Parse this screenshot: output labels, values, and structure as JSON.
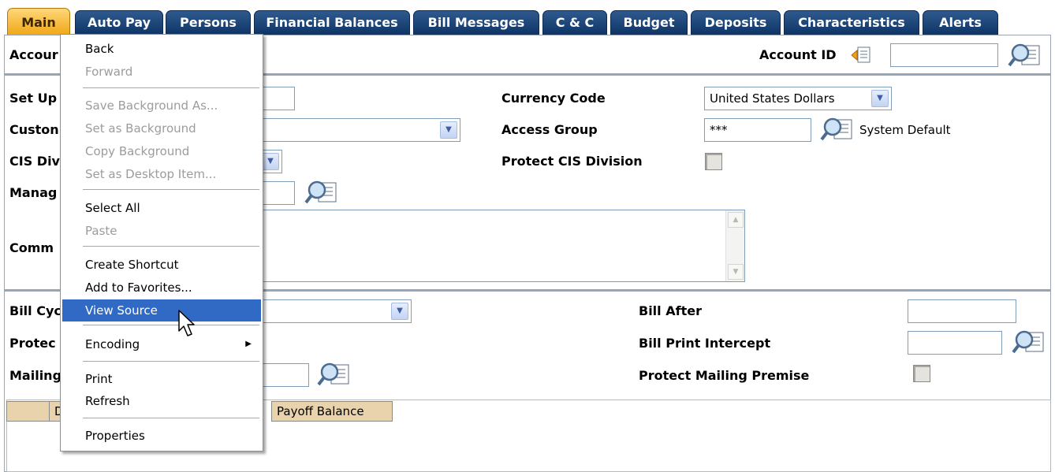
{
  "tabs": [
    {
      "label": "Main",
      "active": true
    },
    {
      "label": "Auto Pay"
    },
    {
      "label": "Persons"
    },
    {
      "label": "Financial Balances"
    },
    {
      "label": "Bill Messages"
    },
    {
      "label": "C & C"
    },
    {
      "label": "Budget"
    },
    {
      "label": "Deposits"
    },
    {
      "label": "Characteristics"
    },
    {
      "label": "Alerts"
    }
  ],
  "header": {
    "account_label_partial": "Accour",
    "account_id_label": "Account ID",
    "account_id_value": ""
  },
  "form": {
    "setup_label": "Set Up",
    "customer_label": "Custon",
    "cis_division_label": "CIS Div",
    "manager_label": "Manag",
    "comments_label": "Comm",
    "currency_code_label": "Currency Code",
    "currency_code_value": "United States Dollars",
    "access_group_label": "Access Group",
    "access_group_value": "***",
    "access_group_desc": "System Default",
    "protect_cis_label": "Protect CIS Division",
    "bill_cycle_label": "Bill Cyc",
    "protect_label": "Protec",
    "mailing_label": "Mailing",
    "bill_after_label": "Bill After",
    "bill_print_intercept_label": "Bill Print Intercept",
    "protect_mailing_premise_label": "Protect Mailing Premise"
  },
  "grid": {
    "col1_partial": "D",
    "col_payoff": "Payoff Balance"
  },
  "context_menu": {
    "items": [
      {
        "label": "Back",
        "disabled": false
      },
      {
        "label": "Forward",
        "disabled": true
      },
      {
        "label": "Save Background As...",
        "disabled": true
      },
      {
        "label": "Set as Background",
        "disabled": true
      },
      {
        "label": "Copy Background",
        "disabled": true
      },
      {
        "label": "Set as Desktop Item...",
        "disabled": true
      },
      {
        "label": "Select All",
        "disabled": false
      },
      {
        "label": "Paste",
        "disabled": true
      },
      {
        "label": "Create Shortcut",
        "disabled": false
      },
      {
        "label": "Add to Favorites...",
        "disabled": false
      },
      {
        "label": "View Source",
        "disabled": false,
        "highlighted": true
      },
      {
        "label": "Encoding",
        "disabled": false,
        "submenu": true
      },
      {
        "label": "Print",
        "disabled": false
      },
      {
        "label": "Refresh",
        "disabled": false
      },
      {
        "label": "Properties",
        "disabled": false
      }
    ]
  },
  "colors": {
    "tab_blue": "#1a4277",
    "tab_active": "#f5b52a",
    "menu_highlight": "#316ac5",
    "grid_header": "#e8d3ad"
  }
}
